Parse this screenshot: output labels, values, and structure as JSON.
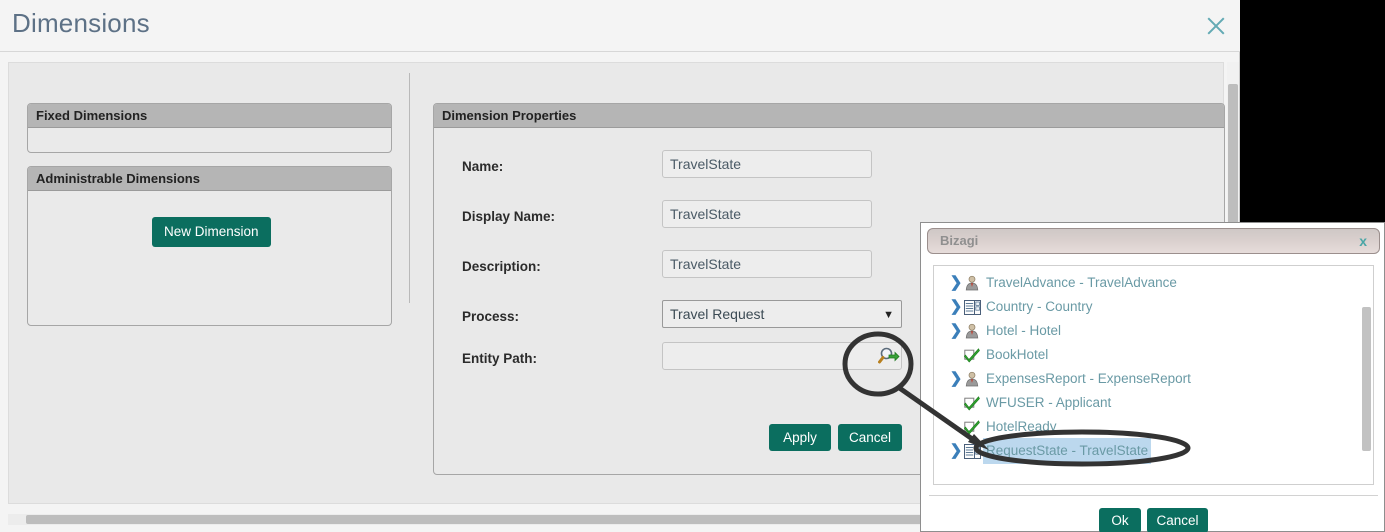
{
  "window": {
    "title": "Dimensions",
    "close_icon": "close-icon"
  },
  "left_panel": {
    "fixed_dimensions": {
      "header": "Fixed Dimensions",
      "items": []
    },
    "administrable_dimensions": {
      "header": "Administrable Dimensions",
      "new_dimension_label": "New Dimension"
    }
  },
  "dimension_properties": {
    "header": "Dimension Properties",
    "fields": [
      {
        "label": "Name:",
        "value": "TravelState",
        "placeholder": ""
      },
      {
        "label": "Display Name:",
        "value": "TravelState",
        "placeholder": ""
      },
      {
        "label": "Description:",
        "value": "TravelState",
        "placeholder": ""
      }
    ],
    "process": {
      "label": "Process:",
      "value": "Travel Request",
      "caret_icon": "chevron-down-icon"
    },
    "entity_path": {
      "label": "Entity Path:",
      "value": "",
      "browse_icon": "magnifier-search-icon"
    },
    "apply_label": "Apply",
    "cancel_label": "Cancel"
  },
  "bizagi_dialog": {
    "title": "Bizagi",
    "close_label": "x",
    "tree": [
      {
        "label": "TravelAdvance - TravelAdvance",
        "icon": "person-icon",
        "expandable": true,
        "selected": false
      },
      {
        "label": "Country - Country",
        "icon": "table-icon",
        "expandable": true,
        "selected": false
      },
      {
        "label": "Hotel - Hotel",
        "icon": "person-icon",
        "expandable": true,
        "selected": false
      },
      {
        "label": "BookHotel",
        "icon": "check-icon",
        "expandable": false,
        "selected": false
      },
      {
        "label": "ExpensesReport - ExpenseReport",
        "icon": "person-icon",
        "expandable": true,
        "selected": false
      },
      {
        "label": "WFUSER - Applicant",
        "icon": "check-icon",
        "expandable": false,
        "selected": false
      },
      {
        "label": "HotelReady",
        "icon": "check-icon",
        "expandable": false,
        "selected": false
      },
      {
        "label": "RequestState - TravelState",
        "icon": "table-icon",
        "expandable": true,
        "selected": true
      }
    ],
    "ok_label": "Ok",
    "cancel_label": "Cancel"
  },
  "colors": {
    "accent_green": "#0b6e5f",
    "title_text": "#5d7186",
    "tree_text": "#6a9aa5",
    "selection": "#bcd8ee",
    "panel_header": "#b5b5b5",
    "annotation": "#333333"
  }
}
